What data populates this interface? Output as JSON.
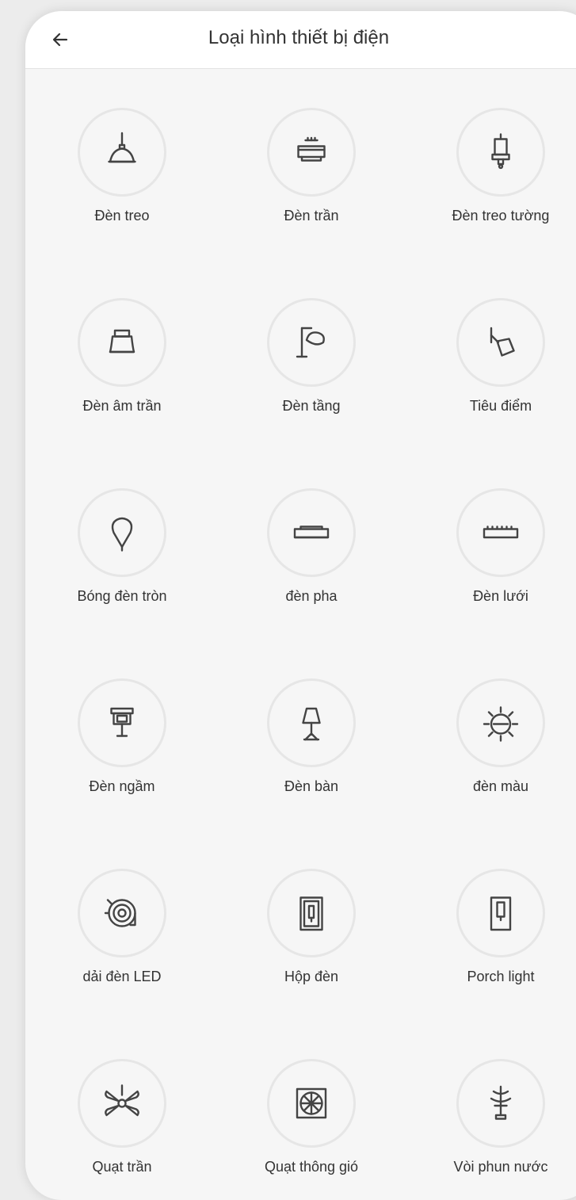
{
  "header": {
    "title": "Loại hình thiết bị điện",
    "back_icon": "arrow-left-icon"
  },
  "items": [
    {
      "label": "Đèn treo",
      "icon": "pendant-lamp-icon"
    },
    {
      "label": "Đèn trần",
      "icon": "ceiling-light-icon"
    },
    {
      "label": "Đèn treo tường",
      "icon": "wall-lamp-icon"
    },
    {
      "label": "Đèn âm trần",
      "icon": "recessed-light-icon"
    },
    {
      "label": "Đèn tầng",
      "icon": "floor-lamp-icon"
    },
    {
      "label": "Tiêu điểm",
      "icon": "spotlight-icon"
    },
    {
      "label": "Bóng đèn tròn",
      "icon": "light-bulb-icon"
    },
    {
      "label": "đèn pha",
      "icon": "flood-light-icon"
    },
    {
      "label": "Đèn lưới",
      "icon": "grid-light-icon"
    },
    {
      "label": "Đèn ngầm",
      "icon": "inground-light-icon"
    },
    {
      "label": "Đèn bàn",
      "icon": "desk-lamp-icon"
    },
    {
      "label": "đèn màu",
      "icon": "color-light-icon"
    },
    {
      "label": "dải đèn LED",
      "icon": "led-strip-icon"
    },
    {
      "label": "Hộp đèn",
      "icon": "light-box-icon"
    },
    {
      "label": "Porch light",
      "icon": "porch-light-icon"
    },
    {
      "label": "Quạt trần",
      "icon": "ceiling-fan-icon"
    },
    {
      "label": "Quạt thông gió",
      "icon": "ventilation-fan-icon"
    },
    {
      "label": "Vòi phun nước",
      "icon": "fountain-icon"
    }
  ],
  "colors": {
    "background": "#f6f6f6",
    "header": "#ffffff",
    "circle_border": "#e6e6e6",
    "icon_stroke": "#444444",
    "text": "#333333"
  }
}
